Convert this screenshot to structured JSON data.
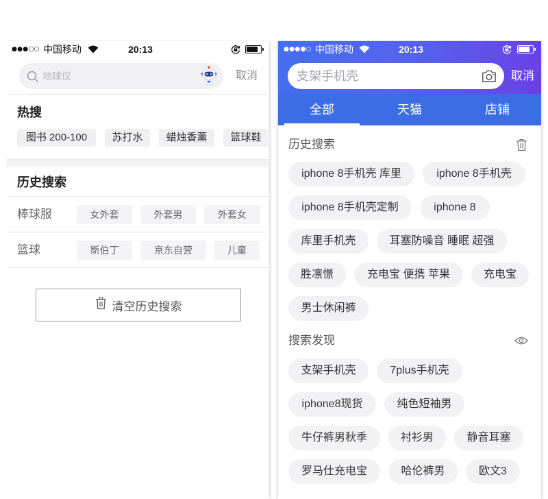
{
  "theme": {
    "header_gradient_start": "#456fef",
    "header_gradient_mid": "#5760ee",
    "header_gradient_end": "#6b3fe5",
    "tab_bar": "#3c6de5",
    "tag_background": "#f2f2f4"
  },
  "left": {
    "status": {
      "signal": "●●●○○",
      "carrier": "中国移动",
      "time": "20:13"
    },
    "search": {
      "icon": "search-icon",
      "placeholder": "地球仪",
      "mascot_icon": "robot-mascot-icon",
      "cancel": "取消"
    },
    "hot_search": {
      "title": "热搜",
      "tags": [
        "图书 200-100",
        "苏打水",
        "蜡烛香薰",
        "篮球鞋"
      ]
    },
    "history": {
      "title": "历史搜索",
      "rows": [
        {
          "keyword": "棒球服",
          "suggestions": [
            "女外套",
            "外套男",
            "外套女"
          ]
        },
        {
          "keyword": "篮球",
          "suggestions": [
            "斯伯丁",
            "京东自营",
            "儿童"
          ]
        }
      ]
    },
    "clear_history": {
      "icon": "trash-icon",
      "label": "清空历史搜索"
    }
  },
  "right": {
    "status": {
      "signal": "●●●●○",
      "carrier": "中国移动",
      "time": "20:13"
    },
    "search": {
      "placeholder": "支架手机壳",
      "camera_icon": "camera-icon",
      "cancel": "取消"
    },
    "tabs": {
      "active_index": 0,
      "items": [
        "全部",
        "天猫",
        "店铺"
      ]
    },
    "history": {
      "title": "历史搜索",
      "action_icon": "trash-icon",
      "tags": [
        "iphone 8手机壳 库里",
        "iphone 8手机壳",
        "iphone 8手机壳定制",
        "iphone 8",
        "库里手机壳",
        "耳塞防噪音 睡眠 超强",
        "胜凛憬",
        "充电宝 便携 苹果",
        "充电宝",
        "男士休闲裤"
      ]
    },
    "discover": {
      "title": "搜索发现",
      "action_icon": "eye-icon",
      "tags": [
        "支架手机壳",
        "7plus手机壳",
        "iphone8现货",
        "纯色短袖男",
        "牛仔裤男秋季",
        "衬衫男",
        "静音耳塞",
        "罗马仕充电宝",
        "哈伦裤男",
        "欧文3"
      ]
    }
  }
}
